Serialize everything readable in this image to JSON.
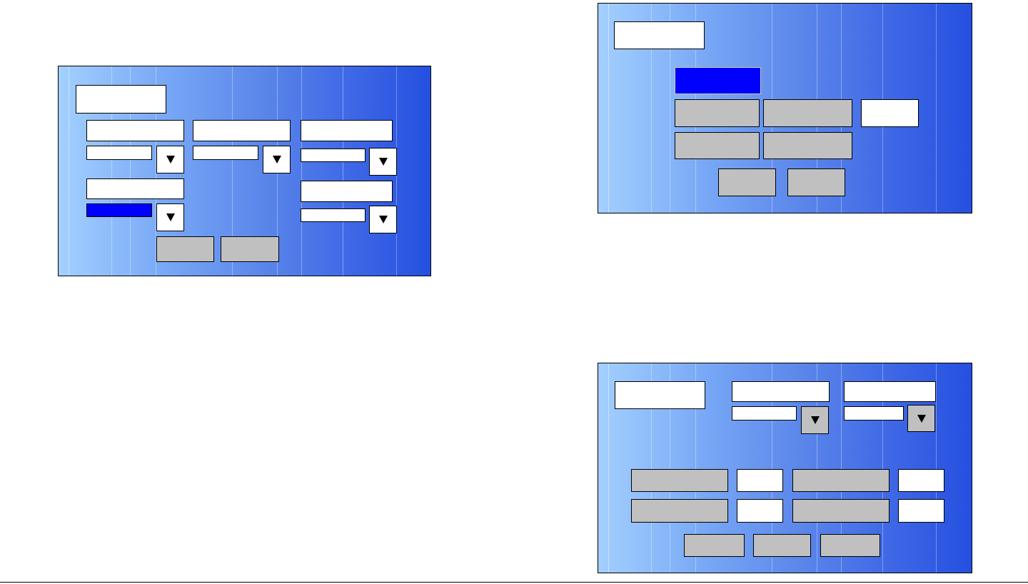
{
  "panels": [
    {
      "kind": "form-a",
      "items": [
        {
          "kind": "label-box"
        },
        {
          "kind": "label-box"
        },
        {
          "kind": "field",
          "selected": false
        },
        {
          "kind": "dropdown-button",
          "disabled": false
        },
        {
          "kind": "label-box"
        },
        {
          "kind": "field",
          "selected": true
        },
        {
          "kind": "dropdown-button",
          "disabled": false
        },
        {
          "kind": "label-box"
        },
        {
          "kind": "field",
          "selected": false
        },
        {
          "kind": "dropdown-button",
          "disabled": false
        },
        {
          "kind": "label-box"
        },
        {
          "kind": "field",
          "selected": false
        },
        {
          "kind": "dropdown-button",
          "disabled": false
        },
        {
          "kind": "label-box"
        },
        {
          "kind": "field",
          "selected": false
        },
        {
          "kind": "dropdown-button",
          "disabled": false
        },
        {
          "kind": "button",
          "selected": false
        },
        {
          "kind": "button",
          "selected": false
        }
      ]
    },
    {
      "kind": "form-b",
      "items": [
        {
          "kind": "label-box"
        },
        {
          "kind": "button",
          "selected": true
        },
        {
          "kind": "button",
          "selected": false
        },
        {
          "kind": "button",
          "selected": false
        },
        {
          "kind": "field",
          "selected": false
        },
        {
          "kind": "button",
          "selected": false
        },
        {
          "kind": "button",
          "selected": false
        },
        {
          "kind": "button",
          "selected": false
        },
        {
          "kind": "button",
          "selected": false
        }
      ]
    },
    {
      "kind": "form-c",
      "items": [
        {
          "kind": "label-box"
        },
        {
          "kind": "label-box"
        },
        {
          "kind": "field",
          "selected": false
        },
        {
          "kind": "dropdown-button",
          "disabled": true
        },
        {
          "kind": "label-box"
        },
        {
          "kind": "field",
          "selected": false
        },
        {
          "kind": "dropdown-button",
          "disabled": true
        },
        {
          "kind": "button",
          "selected": false
        },
        {
          "kind": "field",
          "selected": false
        },
        {
          "kind": "button",
          "selected": false
        },
        {
          "kind": "field",
          "selected": false
        },
        {
          "kind": "button",
          "selected": false
        },
        {
          "kind": "field",
          "selected": false
        },
        {
          "kind": "button",
          "selected": false
        },
        {
          "kind": "field",
          "selected": false
        },
        {
          "kind": "button",
          "selected": false
        },
        {
          "kind": "button",
          "selected": false
        },
        {
          "kind": "button",
          "selected": false
        }
      ]
    }
  ]
}
